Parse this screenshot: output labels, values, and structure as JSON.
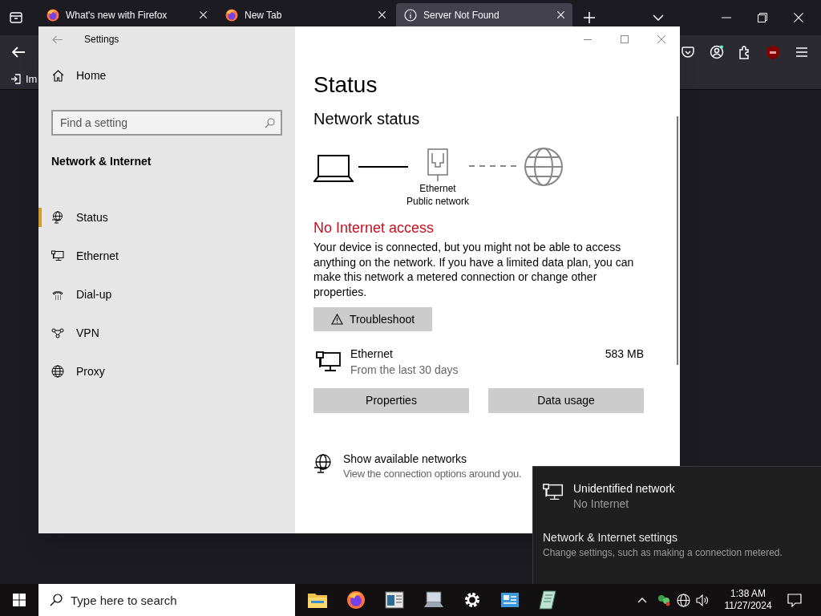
{
  "browser": {
    "tabs": [
      {
        "title": "What's new with Firefox",
        "kind": "firefox",
        "selected": false
      },
      {
        "title": "New Tab",
        "kind": "firefox",
        "selected": false
      },
      {
        "title": "Server Not Found",
        "kind": "info",
        "selected": true
      }
    ],
    "bookmark": "Im"
  },
  "settings": {
    "title": "Settings",
    "home": "Home",
    "search_placeholder": "Find a setting",
    "section": "Network & Internet",
    "nav": [
      {
        "label": "Status",
        "selected": true
      },
      {
        "label": "Ethernet",
        "selected": false
      },
      {
        "label": "Dial-up",
        "selected": false
      },
      {
        "label": "VPN",
        "selected": false
      },
      {
        "label": "Proxy",
        "selected": false
      }
    ],
    "page": {
      "title": "Status",
      "subtitle": "Network status",
      "adapter_label": "Ethernet",
      "adapter_network": "Public network",
      "heading": "No Internet access",
      "message": "Your device is connected, but you might not be able to access anything on the network. If you have a limited data plan, you can make this network a metered connection or change other properties.",
      "troubleshoot": "Troubleshoot",
      "connection": {
        "name": "Ethernet",
        "period": "From the last 30 days",
        "usage": "583 MB"
      },
      "buttons": [
        "Properties",
        "Data usage"
      ],
      "networks": {
        "title": "Show available networks",
        "subtitle": "View the connection options around you."
      }
    }
  },
  "flyout": {
    "network": "Unidentified network",
    "status": "No Internet",
    "link": "Network & Internet settings",
    "hint": "Change settings, such as making a connection metered."
  },
  "taskbar": {
    "search_placeholder": "Type here to search",
    "time": "1:38 AM",
    "date": "11/27/2024"
  }
}
